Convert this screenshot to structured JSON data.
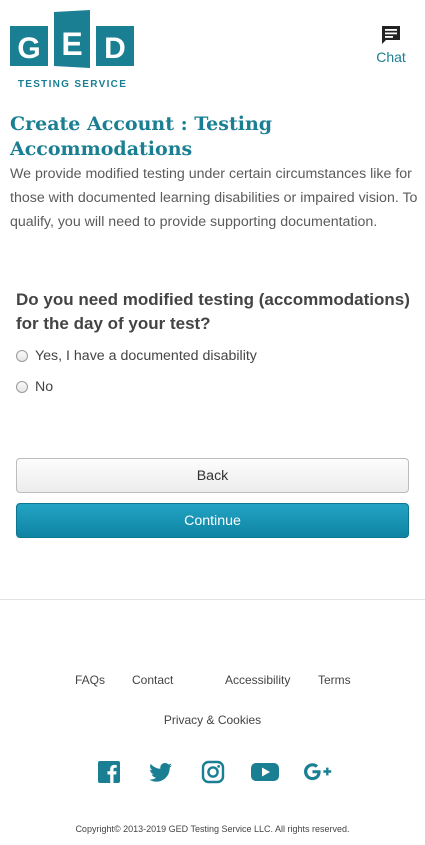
{
  "header": {
    "logo_text": "GED",
    "logo_subtitle": "TESTING SERVICE",
    "chat_label": "Chat"
  },
  "page": {
    "title": "Create Account : Testing Accommodations",
    "intro": "We provide modified testing under certain circumstances like for those with documented learning disabilities or impaired vision. To qualify, you will need to provide supporting documentation."
  },
  "form": {
    "question": "Do you need modified testing (accommodations) for the day of your test?",
    "options": [
      {
        "label": "Yes, I have a documented disability",
        "selected": false
      },
      {
        "label": "No",
        "selected": false
      }
    ],
    "back_label": "Back",
    "continue_label": "Continue"
  },
  "footer": {
    "links": [
      "FAQs",
      "Contact",
      "Accessibility",
      "Terms"
    ],
    "privacy": "Privacy & Cookies",
    "social": [
      "facebook-icon",
      "twitter-icon",
      "instagram-icon",
      "youtube-icon",
      "google-plus-icon"
    ],
    "copyright": "Copyright© 2013-2019 GED Testing Service LLC. All rights reserved."
  },
  "colors": {
    "brand": "#1a7f93",
    "continue_button": "#1590b1"
  }
}
